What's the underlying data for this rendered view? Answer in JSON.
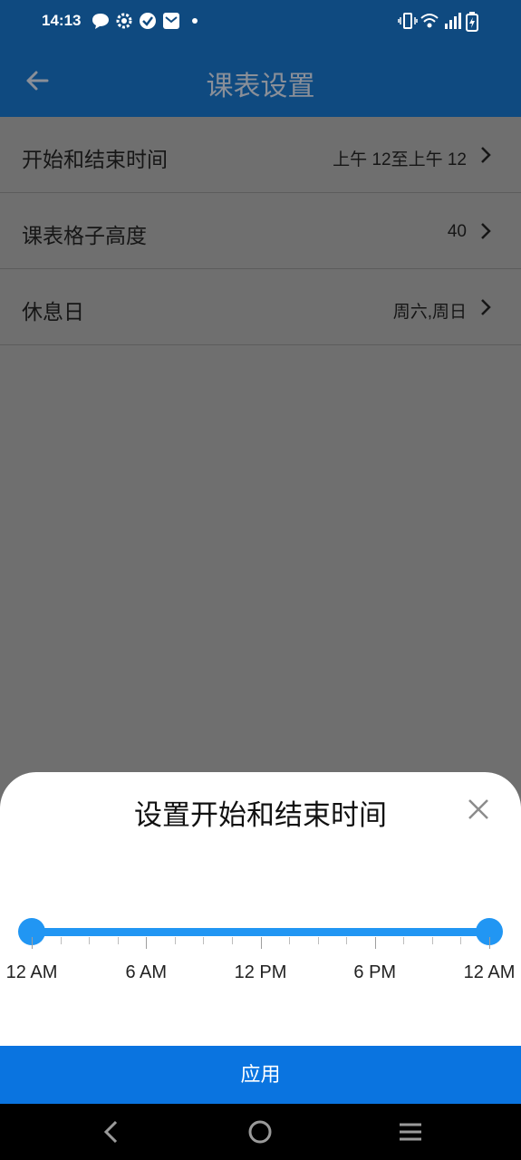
{
  "status_bar": {
    "time": "14:13",
    "left_icons": [
      "chat-bubble-icon",
      "gear-icon",
      "check-circle-icon",
      "mail-icon",
      "dot-icon"
    ],
    "right_icons": [
      "vibrate-icon",
      "wifi-icon",
      "signal-icon",
      "battery-charging-icon"
    ]
  },
  "app_bar": {
    "title": "课表设置",
    "back_icon": "arrow-left-icon"
  },
  "settings": {
    "items": [
      {
        "label": "开始和结束时间",
        "value": "上午 12至上午 12"
      },
      {
        "label": "课表格子高度",
        "value": "40"
      },
      {
        "label": "休息日",
        "value": "周六,周日"
      }
    ]
  },
  "sheet": {
    "title": "设置开始和结束时间",
    "close_icon": "close-icon",
    "slider": {
      "range_start": "12 AM",
      "range_end": "12 AM",
      "start_fraction": 0.0,
      "end_fraction": 1.0,
      "tick_labels": [
        "12 AM",
        "6 AM",
        "12 PM",
        "6 PM",
        "12 AM"
      ],
      "accent": "#2196f3"
    },
    "apply_label": "应用",
    "apply_color": "#0a74e0"
  },
  "nav_bar": {
    "icons": [
      "back-triangle-icon",
      "home-circle-icon",
      "menu-lines-icon"
    ]
  }
}
